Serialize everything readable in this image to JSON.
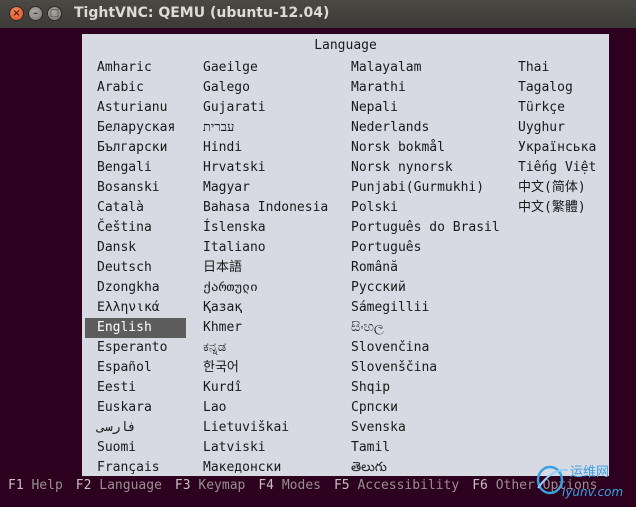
{
  "window": {
    "title": "TightVNC: QEMU (ubuntu-12.04)"
  },
  "dialog": {
    "title": "Language",
    "selected": "English",
    "columns": [
      [
        "Amharic",
        "Arabic",
        "Asturianu",
        "Беларуская",
        "Български",
        "Bengali",
        "Bosanski",
        "Català",
        "Čeština",
        "Dansk",
        "Deutsch",
        "Dzongkha",
        "Ελληνικά",
        "English",
        "Esperanto",
        "Español",
        "Eesti",
        "Euskara",
        "فارسی",
        "Suomi",
        "Français"
      ],
      [
        "Gaeilge",
        "Galego",
        "Gujarati",
        "עברית",
        "Hindi",
        "Hrvatski",
        "Magyar",
        "Bahasa Indonesia",
        "Íslenska",
        "Italiano",
        "日本語",
        "ქართული",
        "Қазақ",
        "Khmer",
        "ಕನ್ನಡ",
        "한국어",
        "Kurdî",
        "Lao",
        "Lietuviškai",
        "Latviski",
        "Македонски"
      ],
      [
        "Malayalam",
        "Marathi",
        "Nepali",
        "Nederlands",
        "Norsk bokmål",
        "Norsk nynorsk",
        "Punjabi(Gurmukhi)",
        "Polski",
        "Português do Brasil",
        "Português",
        "Română",
        "Русский",
        "Sámegillii",
        "සිංහල",
        "Slovenčina",
        "Slovenščina",
        "Shqip",
        "Српски",
        "Svenska",
        "Tamil",
        "తెలుగు"
      ],
      [
        "Thai",
        "Tagalog",
        "Türkçe",
        "Uyghur",
        "Українська",
        "Tiếng Việt",
        "中文(简体)",
        "中文(繁體)"
      ]
    ]
  },
  "function_keys": [
    {
      "key": "F1",
      "label": "Help"
    },
    {
      "key": "F2",
      "label": "Language"
    },
    {
      "key": "F3",
      "label": "Keymap"
    },
    {
      "key": "F4",
      "label": "Modes"
    },
    {
      "key": "F5",
      "label": "Accessibility"
    },
    {
      "key": "F6",
      "label": "Other Options"
    }
  ],
  "watermark": {
    "text": "运维网",
    "url_text": "iyunv.com"
  },
  "colors": {
    "background": "#2c001e",
    "dialog": "#d7d9e3",
    "selection": "#5d5d5d"
  }
}
